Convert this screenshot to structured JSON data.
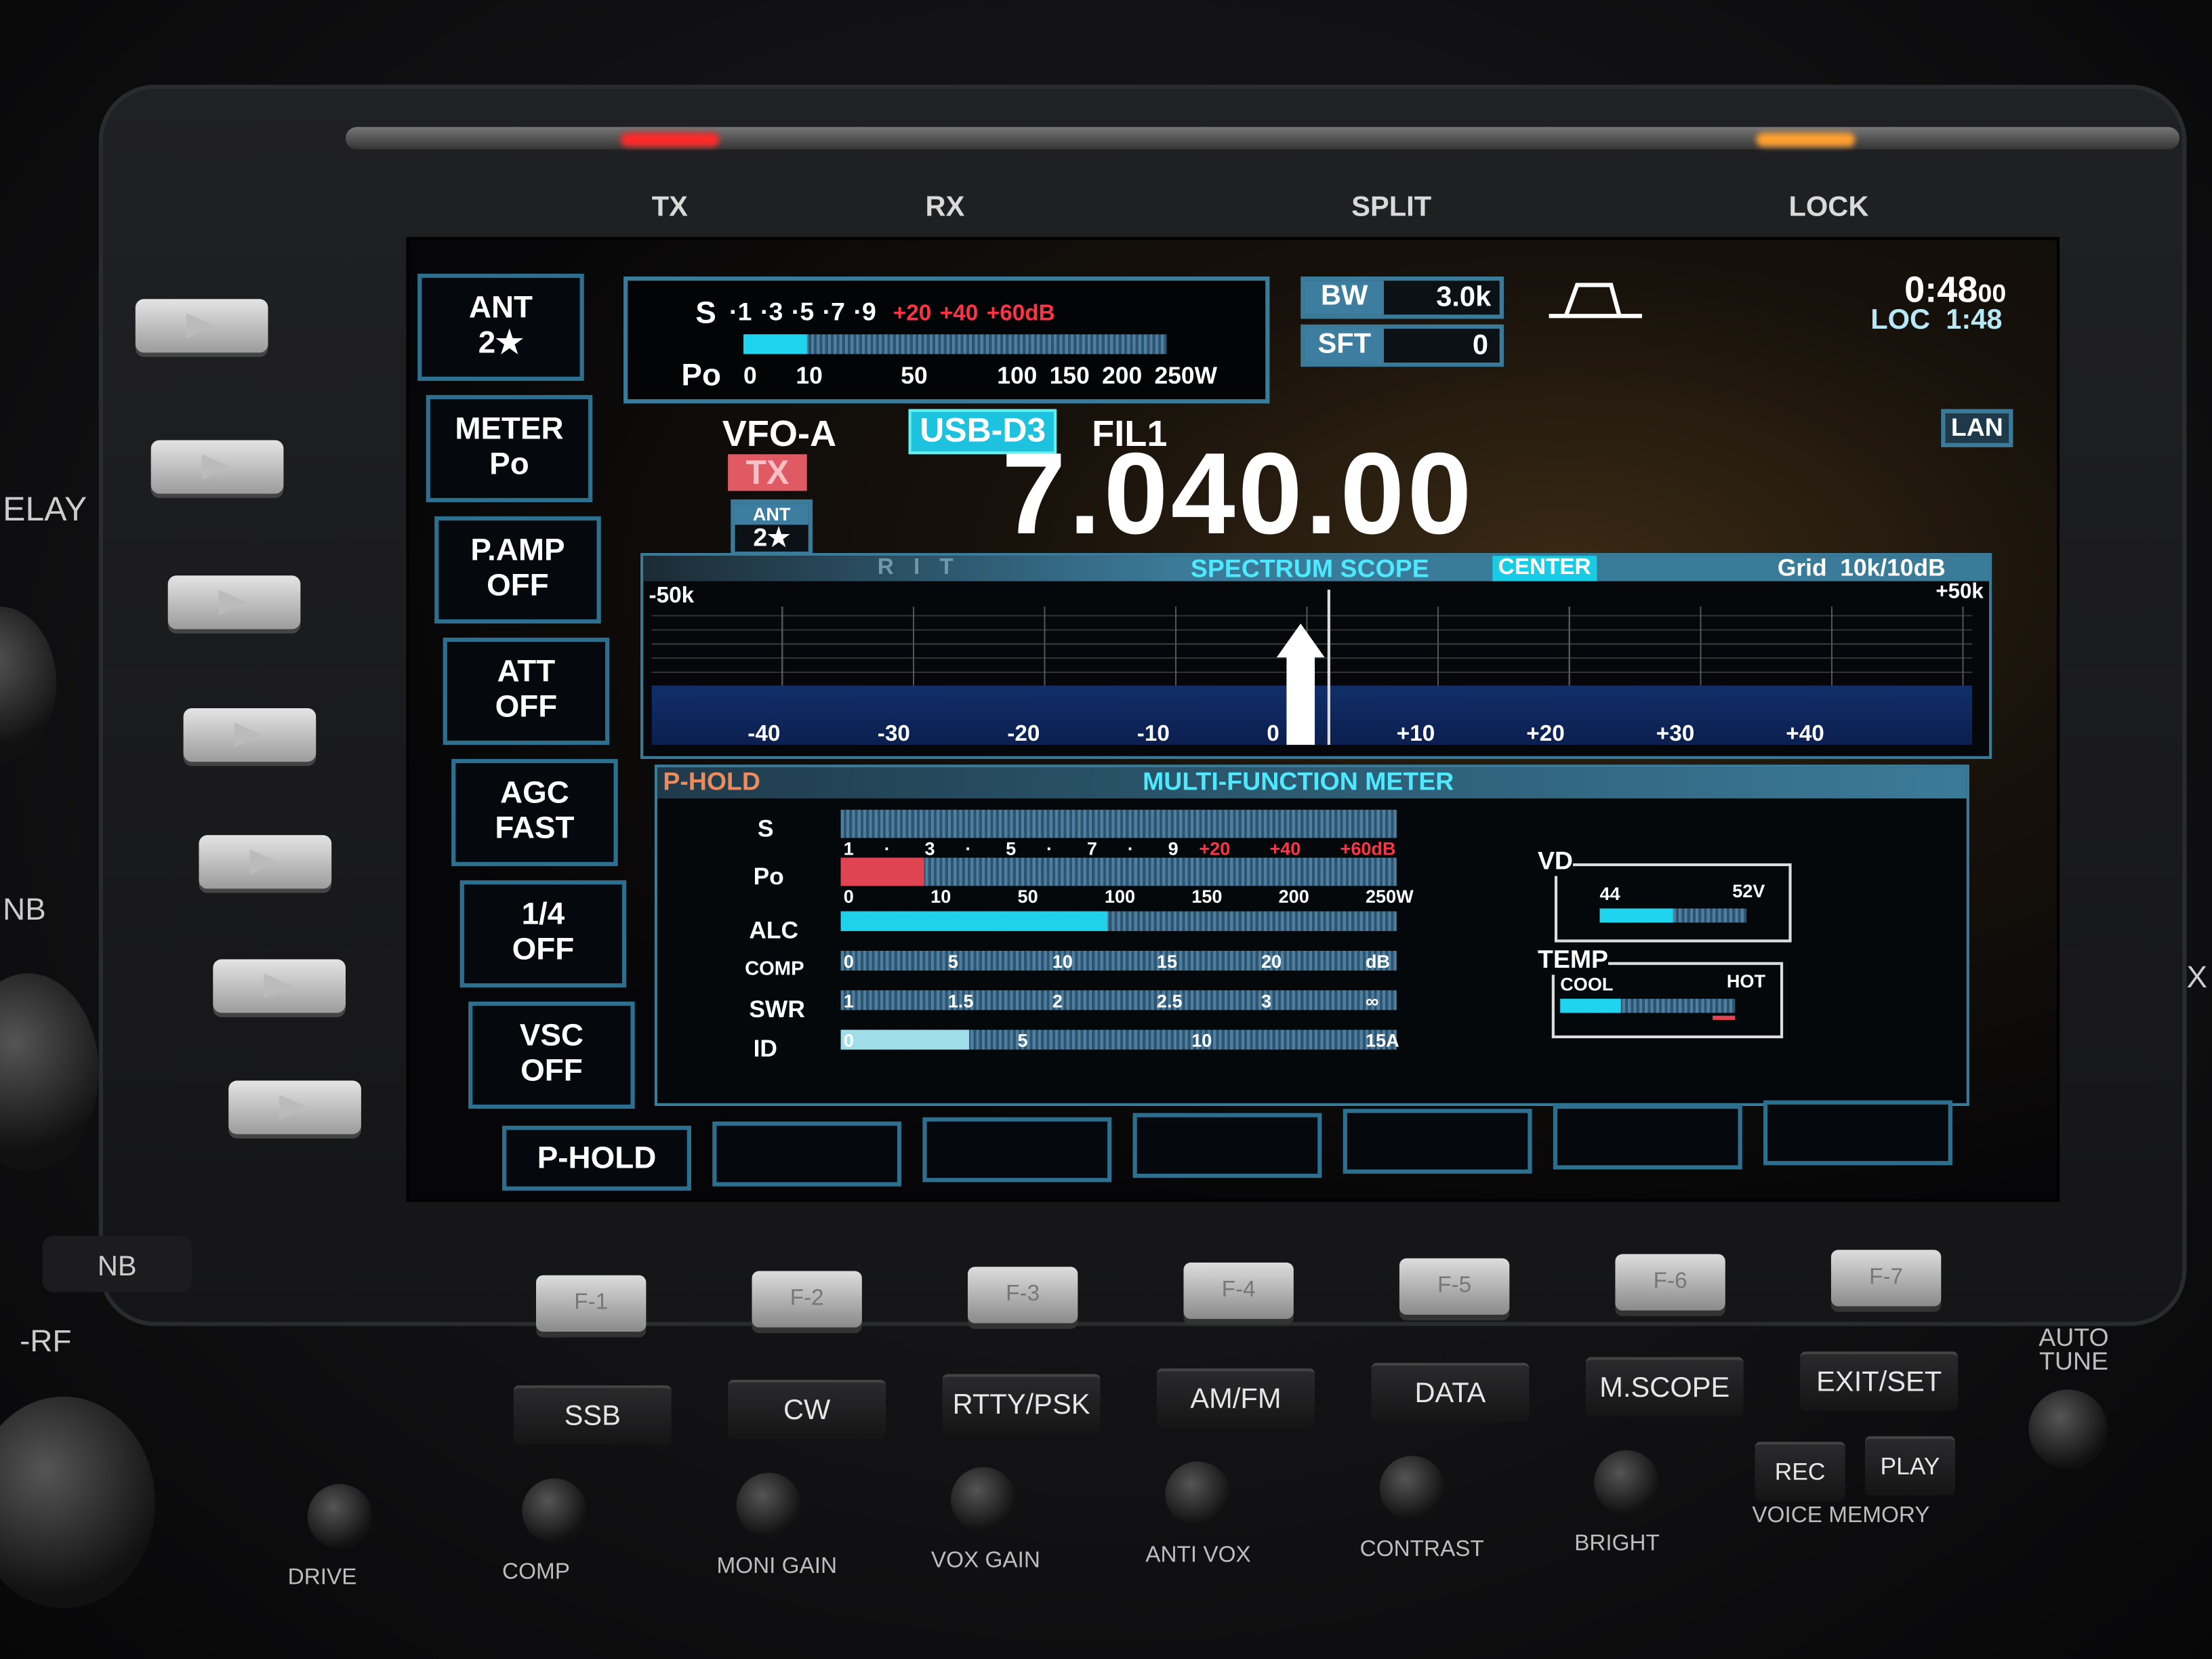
{
  "indicators": {
    "tx": "TX",
    "rx": "RX",
    "split": "SPLIT",
    "lock": "LOCK"
  },
  "side_labels": {
    "relay": "ELAY",
    "nb_left": "NB",
    "nb_button": "NB",
    "rf": "-RF",
    "x": "X"
  },
  "softkeys": [
    {
      "l1": "ANT",
      "l2": "2★"
    },
    {
      "l1": "METER",
      "l2": "Po"
    },
    {
      "l1": "P.AMP",
      "l2": "OFF"
    },
    {
      "l1": "ATT",
      "l2": "OFF"
    },
    {
      "l1": "AGC",
      "l2": "FAST"
    },
    {
      "l1": "1/4",
      "l2": "OFF"
    },
    {
      "l1": "VSC",
      "l2": "OFF"
    }
  ],
  "bottom_softkeys": [
    "P-HOLD",
    "",
    "",
    "",
    "",
    "",
    ""
  ],
  "top_meter": {
    "s_label": "S",
    "s_scale": [
      "·1",
      "·3",
      "·5",
      "·7",
      "·9"
    ],
    "s_over": [
      "+20",
      "+40",
      "+60dB"
    ],
    "po_label": "Po",
    "po_scale": [
      "0",
      "10",
      "50",
      "100",
      "150",
      "200",
      "250W"
    ],
    "level_pct": 15
  },
  "bw": {
    "label": "BW",
    "value": "3.0k"
  },
  "sft": {
    "label": "SFT",
    "value": "0"
  },
  "filter_icon": "passband-trapezoid-icon",
  "clock": {
    "time": "0:48",
    "seconds": "00",
    "loc_label": "LOC",
    "loc_time": "1:48"
  },
  "lan": "LAN",
  "vfo": {
    "name": "VFO-A",
    "mode": "USB-D3",
    "filter": "FIL1",
    "tx": "TX",
    "ant_label": "ANT",
    "ant_value": "2★",
    "frequency": "7.040.00"
  },
  "scope": {
    "rit": "RIT",
    "title": "SPECTRUM SCOPE",
    "mode": "CENTER",
    "grid": "Grid  10k/10dB",
    "left_span": "-50k",
    "right_span": "+50k",
    "scale": [
      "-40",
      "-30",
      "-20",
      "-10",
      "0",
      "+10",
      "+20",
      "+30",
      "+40"
    ]
  },
  "mfm": {
    "hold": "P-HOLD",
    "title": "MULTI-FUNCTION METER",
    "rows": [
      {
        "label": "S",
        "ticks": [
          "1",
          "·",
          "3",
          "·",
          "5",
          "·",
          "7",
          "·",
          "9"
        ],
        "over": [
          "+20",
          "+40",
          "+60dB"
        ],
        "level_pct": 0
      },
      {
        "label": "Po",
        "ticks": [
          "0",
          "10",
          "50",
          "100",
          "150",
          "200",
          "250W"
        ],
        "level_pct": 15,
        "color": "#e04352"
      },
      {
        "label": "ALC",
        "ticks": [],
        "level_pct": 48,
        "color": "#1ed2ec"
      },
      {
        "label": "COMP",
        "ticks": [
          "0",
          "5",
          "10",
          "15",
          "20",
          "dB"
        ],
        "level_pct": 0
      },
      {
        "label": "SWR",
        "ticks": [
          "1",
          "1.5",
          "2",
          "2.5",
          "3",
          "∞"
        ],
        "level_pct": 0
      },
      {
        "label": "ID",
        "ticks": [
          "0",
          "5",
          "10",
          "15A"
        ],
        "level_pct": 23,
        "color": "#9fdde8"
      }
    ],
    "vd": {
      "label": "VD",
      "min": "44",
      "max": "52V",
      "level_pct": 50
    },
    "temp": {
      "label": "TEMP",
      "min": "COOL",
      "max": "HOT",
      "level_pct": 35
    }
  },
  "fkeys": [
    "F-1",
    "F-2",
    "F-3",
    "F-4",
    "F-5",
    "F-6",
    "F-7"
  ],
  "mode_buttons": [
    "SSB",
    "CW",
    "RTTY/PSK",
    "AM/FM",
    "DATA",
    "M.SCOPE",
    "EXIT/SET"
  ],
  "auto_tune": "AUTO TUNE",
  "voice": {
    "rec": "REC",
    "play": "PLAY",
    "label": "VOICE MEMORY"
  },
  "knobs": [
    "DRIVE",
    "COMP",
    "MONI GAIN",
    "VOX GAIN",
    "ANTI VOX",
    "CONTRAST",
    "BRIGHT"
  ],
  "colors": {
    "accent": "#21d3ee",
    "alert": "#ff3345",
    "frame": "#3b7b9a"
  }
}
